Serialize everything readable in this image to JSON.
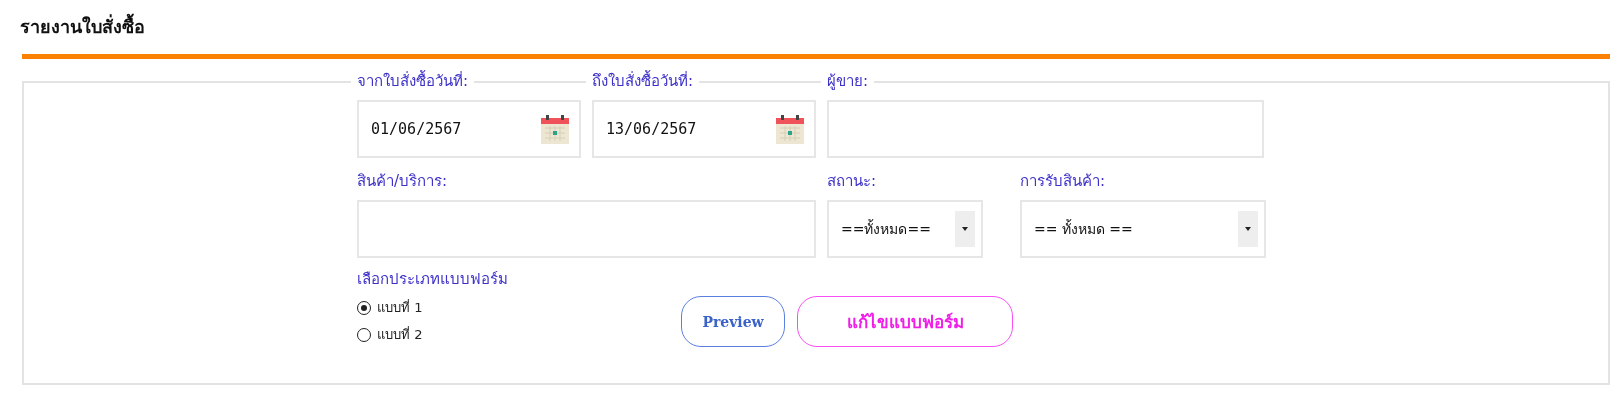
{
  "title": "รายงานใบสั่งซื้อ",
  "date_from": {
    "label": "จากใบสั่งซื้อวันที่:",
    "value": "01/06/2567"
  },
  "date_to": {
    "label": "ถึงใบสั่งซื้อวันที่:",
    "value": "13/06/2567"
  },
  "seller": {
    "label": "ผู้ขาย:"
  },
  "product": {
    "label": "สินค้า/บริการ:"
  },
  "status": {
    "label": "สถานะ:",
    "value": "==ทั้งหมด=="
  },
  "receive": {
    "label": "การรับสินค้า:",
    "value": "== ทั้งหมด =="
  },
  "form_type": {
    "label": "เลือกประเภทแบบฟอร์ม",
    "options": [
      {
        "label": "แบบที่ 1",
        "selected": true
      },
      {
        "label": "แบบที่ 2",
        "selected": false
      }
    ]
  },
  "buttons": [
    {
      "label": "Preview",
      "kind": "preview"
    },
    {
      "label": "แก้ไขแบบฟอร์ม",
      "kind": "edit"
    }
  ]
}
